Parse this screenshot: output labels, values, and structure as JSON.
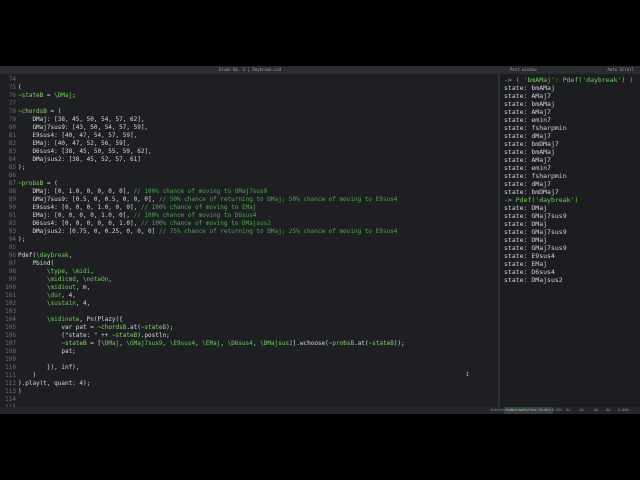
{
  "window": {
    "title": "Etude No. 3 | Daybreak.scd",
    "post_title": "Post window",
    "post_right": "Auto Scroll"
  },
  "editor": {
    "lines": [
      {
        "n": "74",
        "t": ""
      },
      {
        "n": "75",
        "t": "("
      },
      {
        "n": "76",
        "t": "~stateB = \\DMaj;"
      },
      {
        "n": "77",
        "t": ""
      },
      {
        "n": "78",
        "t": "~chordsB = ("
      },
      {
        "n": "79",
        "t": "    DMaj: [38, 45, 50, 54, 57, 62],"
      },
      {
        "n": "80",
        "t": "    GMaj7sus9: [43, 50, 54, 57, 59],"
      },
      {
        "n": "81",
        "t": "    E9sus4: [40, 47, 54, 57, 59],"
      },
      {
        "n": "82",
        "t": "    EMaj: [40, 47, 52, 56, 59],"
      },
      {
        "n": "83",
        "t": "    D6sus4: [38, 45, 50, 55, 59, 62],"
      },
      {
        "n": "84",
        "t": "    DMajsus2: [38, 45, 52, 57, 61]"
      },
      {
        "n": "85",
        "t": ");"
      },
      {
        "n": "86",
        "t": ""
      },
      {
        "n": "87",
        "t": "~probsB = ("
      },
      {
        "n": "88",
        "t": "    DMaj: [0, 1.0, 0, 0, 0, 0], // 100% chance of moving to GMaj7sus9"
      },
      {
        "n": "89",
        "t": "    GMaj7sus9: [0.5, 0, 0.5, 0, 0, 0], // 50% chance of returning to DMaj; 50% chance of moving to E9sus4"
      },
      {
        "n": "90",
        "t": "    E9sus4: [0, 0, 0, 1.0, 0, 0], // 100% chance of moving to EMaj"
      },
      {
        "n": "91",
        "t": "    EMaj: [0, 0, 0, 0, 1.0, 0], // 100% chance of moving to D6sus4"
      },
      {
        "n": "92",
        "t": "    D6sus4: [0, 0, 0, 0, 0, 1.0], // 100% chance of moving to DMajsus2"
      },
      {
        "n": "93",
        "t": "    DMajsus2: [0.75, 0, 0.25, 0, 0, 0] // 75% chance of returning to DMaj; 25% chance of moving to E9sus4"
      },
      {
        "n": "94",
        "t": ");"
      },
      {
        "n": "95",
        "t": ""
      },
      {
        "n": "96",
        "t": "Pdef(\\daybreak,"
      },
      {
        "n": "97",
        "t": "    Pbind("
      },
      {
        "n": "98",
        "t": "        \\type, \\midi,"
      },
      {
        "n": "99",
        "t": "        \\midicmd, \\noteOn,"
      },
      {
        "n": "100",
        "t": "        \\midiout, m,"
      },
      {
        "n": "101",
        "t": "        \\dur, 4,"
      },
      {
        "n": "102",
        "t": "        \\sustain, 4,"
      },
      {
        "n": "103",
        "t": ""
      },
      {
        "n": "104",
        "t": "        \\midinote, Pn(Plazy({"
      },
      {
        "n": "105",
        "t": "            var pat = ~chordsB.at(~stateB);"
      },
      {
        "n": "106",
        "t": "            (\"state: \" ++ ~stateB).postln;"
      },
      {
        "n": "107",
        "t": "            ~stateB = [\\DMaj, \\GMaj7sus9, \\E9sus4, \\EMaj, \\D6sus4, \\DMajsus2].wchoose(~probsB.at(~stateB));"
      },
      {
        "n": "108",
        "t": "            pat;"
      },
      {
        "n": "109",
        "t": ""
      },
      {
        "n": "110",
        "t": "        }), inf),"
      },
      {
        "n": "111",
        "t": "    )"
      },
      {
        "n": "112",
        "t": ").play(t, quant: 4);"
      },
      {
        "n": "113",
        "t": ")"
      },
      {
        "n": "114",
        "t": ""
      },
      {
        "n": "115",
        "t": ""
      }
    ]
  },
  "post": {
    "lines": [
      {
        "t": "-> ( 'bmAMaj': Pdef('daybreak') )",
        "hl": true
      },
      {
        "t": "state: bmAMaj",
        "hl": false
      },
      {
        "t": "state: AMaj7",
        "hl": false
      },
      {
        "t": "state: bmAMaj",
        "hl": false
      },
      {
        "t": "state: AMaj7",
        "hl": false
      },
      {
        "t": "state: emin7",
        "hl": false
      },
      {
        "t": "state: fsharpmin",
        "hl": false
      },
      {
        "t": "state: dMaj7",
        "hl": false
      },
      {
        "t": "state: bmDMaj7",
        "hl": false
      },
      {
        "t": "state: bmAMaj",
        "hl": false
      },
      {
        "t": "state: AMaj7",
        "hl": false
      },
      {
        "t": "state: emin7",
        "hl": false
      },
      {
        "t": "state: fsharpmin",
        "hl": false
      },
      {
        "t": "state: dMaj7",
        "hl": false
      },
      {
        "t": "state: bmDMaj7",
        "hl": false
      },
      {
        "t": "-> Pdef('daybreak')",
        "hl": true
      },
      {
        "t": "state: DMaj",
        "hl": false
      },
      {
        "t": "state: GMaj7sus9",
        "hl": false
      },
      {
        "t": "state: DMaj",
        "hl": false
      },
      {
        "t": "state: GMaj7sus9",
        "hl": false
      },
      {
        "t": "state: DMaj",
        "hl": false
      },
      {
        "t": "state: GMaj7sus9",
        "hl": false
      },
      {
        "t": "state: E9sus4",
        "hl": false
      },
      {
        "t": "state: EMaj",
        "hl": false
      },
      {
        "t": "state: D6sus4",
        "hl": false
      },
      {
        "t": "state: DMajsus2",
        "hl": false
      }
    ]
  },
  "status": {
    "left1": "Total solution",
    "left2": "Find Errors",
    "interp": "Interpreter:",
    "active": "Active",
    "server": "Server:",
    "v1": "0.00%",
    "v2": "0.00%",
    "v3": "0u",
    "v4": "0s",
    "v5": "0g",
    "v6": "0d",
    "v7": "0.0dB"
  }
}
